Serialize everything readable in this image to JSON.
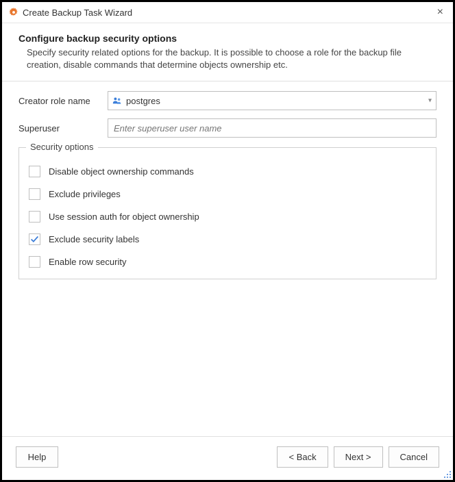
{
  "window": {
    "title": "Create Backup Task Wizard"
  },
  "header": {
    "title": "Configure backup security options",
    "description": "Specify security related options for the backup. It is possible to choose a role for the backup file creation, disable commands that determine objects ownership etc."
  },
  "form": {
    "creator_role": {
      "label": "Creator role name",
      "value": "postgres"
    },
    "superuser": {
      "label": "Superuser",
      "placeholder": "Enter superuser user name",
      "value": ""
    }
  },
  "security_options": {
    "legend": "Security options",
    "items": [
      {
        "label": "Disable object ownership commands",
        "checked": false
      },
      {
        "label": "Exclude privileges",
        "checked": false
      },
      {
        "label": "Use session auth for object ownership",
        "checked": false
      },
      {
        "label": "Exclude security labels",
        "checked": true
      },
      {
        "label": "Enable row security",
        "checked": false
      }
    ]
  },
  "buttons": {
    "help": "Help",
    "back": "< Back",
    "next": "Next >",
    "cancel": "Cancel"
  }
}
